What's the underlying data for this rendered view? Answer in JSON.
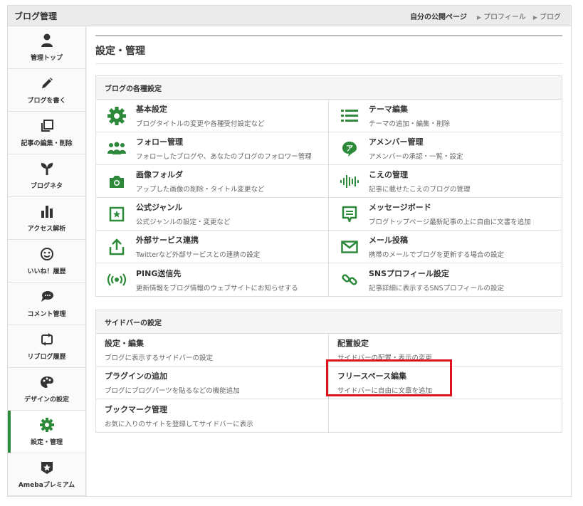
{
  "header": {
    "title": "ブログ管理",
    "links": [
      {
        "label": "自分の公開ページ"
      },
      {
        "label": "プロフィール"
      },
      {
        "label": "ブログ"
      }
    ]
  },
  "sidebar": {
    "items": [
      {
        "label": "管理トップ",
        "icon": "person-icon"
      },
      {
        "label": "ブログを書く",
        "icon": "pencil-icon"
      },
      {
        "label": "記事の編集・削除",
        "icon": "copy-icon"
      },
      {
        "label": "ブログネタ",
        "icon": "sprout-icon"
      },
      {
        "label": "アクセス解析",
        "icon": "bar-chart-icon"
      },
      {
        "label": "いいね！履歴",
        "icon": "smiley-icon"
      },
      {
        "label": "コメント管理",
        "icon": "comment-icon"
      },
      {
        "label": "リブログ履歴",
        "icon": "reblog-icon"
      },
      {
        "label": "デザインの設定",
        "icon": "palette-icon"
      },
      {
        "label": "設定・管理",
        "icon": "gear-icon",
        "active": true
      },
      {
        "label": "Amebaプレミアム",
        "icon": "premium-star-icon"
      }
    ]
  },
  "main": {
    "title": "設定・管理",
    "blog_settings": {
      "heading": "ブログの各種設定",
      "items": [
        {
          "title": "基本設定",
          "desc": "ブログタイトルの変更や各種受付設定など",
          "icon": "gear-icon"
        },
        {
          "title": "テーマ編集",
          "desc": "テーマの追加・編集・削除",
          "icon": "list-icon"
        },
        {
          "title": "フォロー管理",
          "desc": "フォローしたブログや、あなたのブログのフォロワー管理",
          "icon": "people-icon"
        },
        {
          "title": "アメンバー管理",
          "desc": "アメンバーの承認・一覧・設定",
          "icon": "amember-icon"
        },
        {
          "title": "画像フォルダ",
          "desc": "アップした画像の削除・タイトル変更など",
          "icon": "camera-icon"
        },
        {
          "title": "こえの管理",
          "desc": "記事に載せたこえのブログの管理",
          "icon": "voice-wave-icon"
        },
        {
          "title": "公式ジャンル",
          "desc": "公式ジャンルの設定・変更など",
          "icon": "star-box-icon"
        },
        {
          "title": "メッセージボード",
          "desc": "ブログトップページ最新記事の上に自由に文書を追加",
          "icon": "message-board-icon"
        },
        {
          "title": "外部サービス連携",
          "desc": "Twitterなど外部サービスとの連携の設定",
          "icon": "share-upload-icon"
        },
        {
          "title": "メール投稿",
          "desc": "携帯のメールでブログを更新する場合の設定",
          "icon": "mail-icon"
        },
        {
          "title": "PING送信先",
          "desc": "更新情報をブログ情報のウェブサイトにお知らせする",
          "icon": "broadcast-icon"
        },
        {
          "title": "SNSプロフィール設定",
          "desc": "記事詳細に表示するSNSプロフィールの設定",
          "icon": "link-icon"
        }
      ]
    },
    "sidebar_settings": {
      "heading": "サイドバーの設定",
      "items": [
        {
          "title": "設定・編集",
          "desc": "ブログに表示するサイドバーの設定"
        },
        {
          "title": "配置設定",
          "desc": "サイドバーの配置・表示の変更"
        },
        {
          "title": "プラグインの追加",
          "desc": "ブログにブログパーツを貼るなどの機能追加"
        },
        {
          "title": "フリースペース編集",
          "desc": "サイドバーに自由に文章を追加"
        },
        {
          "title": "ブックマーク管理",
          "desc": "お気に入りのサイトを登録してサイドバーに表示"
        }
      ]
    }
  },
  "colors": {
    "accent_green": "#2d8a3b",
    "icon_dark": "#333333",
    "highlight_red": "#e0121b"
  }
}
